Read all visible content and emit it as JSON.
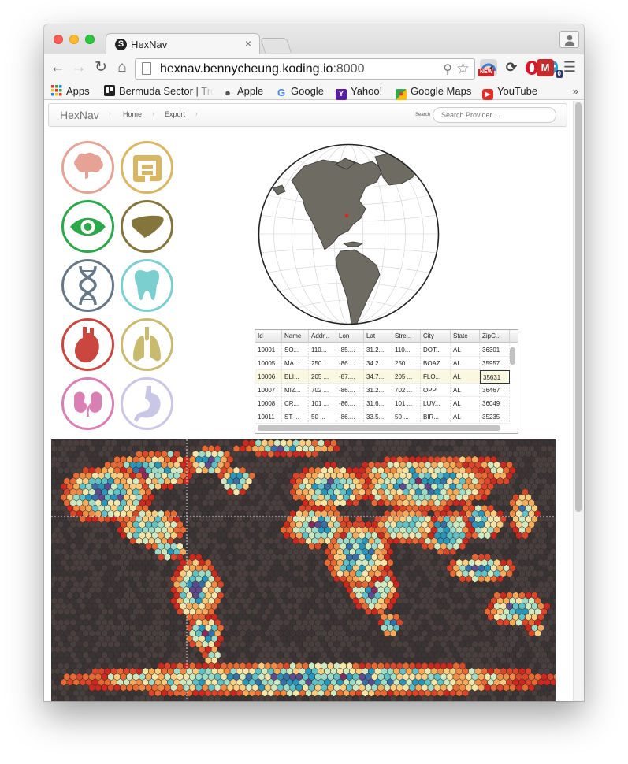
{
  "browser": {
    "tab_title": "HexNav",
    "favicon_letter": "S",
    "tab_close": "×",
    "url_host": "hexnav.bennycheung.koding.io",
    "url_port": ":8000",
    "extensions": {
      "new_badge": "NEW",
      "ghost_count": "0",
      "m_label": "M"
    },
    "bookmarks": [
      {
        "label": "Apps",
        "icon": "apps-grid-icon"
      },
      {
        "label": "Bermuda Sector | Tro",
        "icon": "trello-icon"
      },
      {
        "label": "Apple",
        "icon": "apple-icon"
      },
      {
        "label": "Google",
        "icon": "google-icon"
      },
      {
        "label": "Yahoo!",
        "icon": "yahoo-icon"
      },
      {
        "label": "Google Maps",
        "icon": "maps-icon"
      },
      {
        "label": "YouTube",
        "icon": "youtube-icon"
      }
    ],
    "bookmarks_more": "»"
  },
  "navbar": {
    "brand": "HexNav",
    "links": [
      "Home",
      "Export"
    ],
    "search_label": "Search",
    "search_placeholder": "Search Provider ..."
  },
  "organs": [
    {
      "icon": "brain-icon",
      "color": "#e6a395"
    },
    {
      "icon": "intestines-icon",
      "color": "#d9b662"
    },
    {
      "icon": "eye-icon",
      "color": "#2aa84a"
    },
    {
      "icon": "liver-icon",
      "color": "#84753c"
    },
    {
      "icon": "dna-icon",
      "color": "#667788"
    },
    {
      "icon": "tooth-icon",
      "color": "#7ccfcf"
    },
    {
      "icon": "heart-icon",
      "color": "#c9473e"
    },
    {
      "icon": "lungs-icon",
      "color": "#c8bb6f"
    },
    {
      "icon": "kidneys-icon",
      "color": "#d97fb3"
    },
    {
      "icon": "stomach-icon",
      "color": "#c9c6e6"
    }
  ],
  "globe": {
    "land_color": "#6e6c62",
    "marker_color": "#e0201b"
  },
  "grid": {
    "columns": [
      "Id",
      "Name",
      "Addr...",
      "Lon",
      "Lat",
      "Stre...",
      "City",
      "State",
      "ZipC..."
    ],
    "rows": [
      [
        "10001",
        "SO...",
        "110...",
        "-85....",
        "31.2...",
        "110...",
        "DOT...",
        "AL",
        "36301"
      ],
      [
        "10005",
        "MA...",
        "250...",
        "-86....",
        "34.2...",
        "250...",
        "BOAZ",
        "AL",
        "35957"
      ],
      [
        "10006",
        "ELI...",
        "205 ...",
        "-87....",
        "34.7...",
        "205 ...",
        "FLO...",
        "AL",
        "35631"
      ],
      [
        "10007",
        "MIZ...",
        "702 ...",
        "-86....",
        "31.2...",
        "702 ...",
        "OPP",
        "AL",
        "36467"
      ],
      [
        "10008",
        "CR...",
        "101 ...",
        "-86....",
        "31.6...",
        "101 ...",
        "LUV...",
        "AL",
        "36049"
      ],
      [
        "10011",
        "ST ...",
        "50 ...",
        "-86....",
        "33.5...",
        "50 ...",
        "BIR...",
        "AL",
        "35235"
      ]
    ],
    "selected_row": 2,
    "active_cell_col": 8
  },
  "hexmap": {
    "background": "#3b3434",
    "line_color": "#dddddd"
  }
}
